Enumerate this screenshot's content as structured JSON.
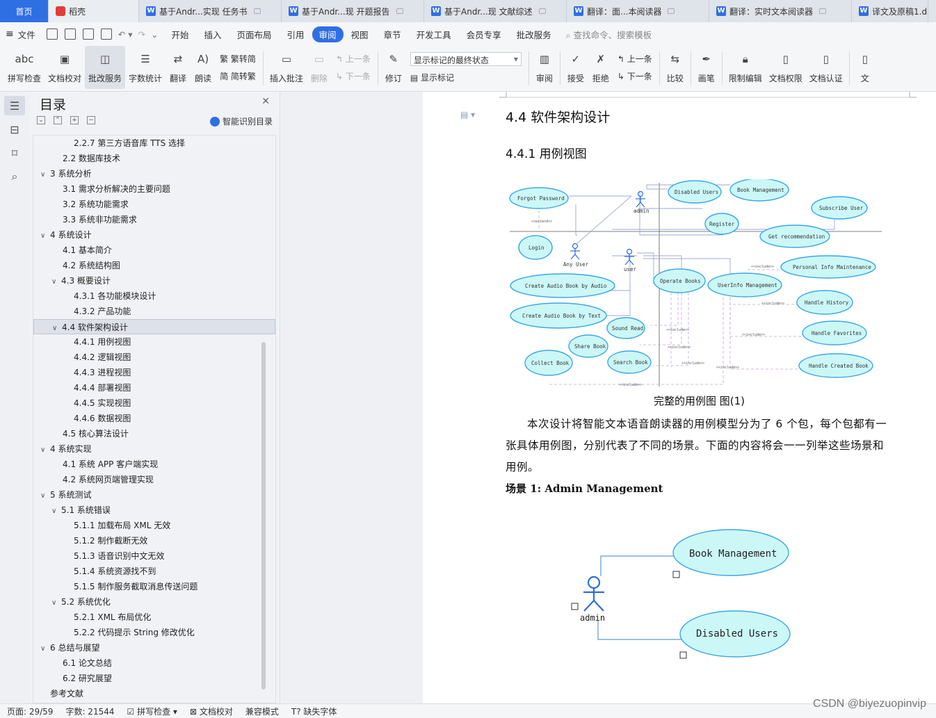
{
  "tabs": {
    "home": "首页",
    "daoke": "稻壳",
    "docs": [
      "基于Andr...实现 任务书",
      "基于Andr...现 开题报告",
      "基于Andr...现 文献综述",
      "翻译：面...本阅读器",
      "翻译：实时文本阅读器",
      "译文及原稿1.doc"
    ]
  },
  "menu": {
    "file": "文件",
    "items": [
      "开始",
      "插入",
      "页面布局",
      "引用",
      "审阅",
      "视图",
      "章节",
      "开发工具",
      "会员专享",
      "批改服务"
    ],
    "active": "审阅",
    "search": "查找命令、搜索模板"
  },
  "ribbon": {
    "spell": "拼写检查",
    "proof": "文档校对",
    "correct": "批改服务",
    "wordcount": "字数统计",
    "translate": "翻译",
    "read": "朗读",
    "trad": "繁转简",
    "simp": "简转繁",
    "insert_comment": "插入批注",
    "delete": "删除",
    "prev": "上一条",
    "next": "下一条",
    "revise": "修订",
    "display_state": "显示标记的最终状态",
    "show_marks": "显示标记",
    "review": "审阅",
    "accept": "接受",
    "reject": "拒绝",
    "prev2": "上一条",
    "next2": "下一条",
    "compare": "比较",
    "pen": "画笔",
    "restrict": "限制编辑",
    "rights": "文档权限",
    "certify": "文档认证",
    "more": "文"
  },
  "toc": {
    "title": "目录",
    "smart": "智能识别目录",
    "items": [
      {
        "text": "2.2.7 第三方语音库 TTS 选择",
        "lvl": 3
      },
      {
        "text": "2.2  数据库技术",
        "lvl": 2
      },
      {
        "text": "3 系统分析",
        "lvl": 1,
        "open": true
      },
      {
        "text": "3.1 需求分析解决的主要问题",
        "lvl": 2
      },
      {
        "text": "3.2 系统功能需求",
        "lvl": 2
      },
      {
        "text": "3.3 系统非功能需求",
        "lvl": 2
      },
      {
        "text": "4  系统设计",
        "lvl": 1,
        "open": true
      },
      {
        "text": "4.1 基本简介",
        "lvl": 2
      },
      {
        "text": "4.2 系统结构图",
        "lvl": 2
      },
      {
        "text": "4.3 概要设计",
        "lvl": 2,
        "open": true
      },
      {
        "text": "4.3.1 各功能模块设计",
        "lvl": 3
      },
      {
        "text": "4.3.2 产品功能",
        "lvl": 3
      },
      {
        "text": "4.4 软件架构设计",
        "lvl": 2,
        "open": true,
        "sel": true
      },
      {
        "text": "4.4.1 用例视图",
        "lvl": 3
      },
      {
        "text": "4.4.2 逻辑视图",
        "lvl": 3
      },
      {
        "text": "4.4.3 进程视图",
        "lvl": 3
      },
      {
        "text": "4.4.4 部署视图",
        "lvl": 3
      },
      {
        "text": "4.4.5 实现视图",
        "lvl": 3
      },
      {
        "text": "4.4.6 数据视图",
        "lvl": 3
      },
      {
        "text": "4.5 核心算法设计",
        "lvl": 2
      },
      {
        "text": "4 系统实现",
        "lvl": 1,
        "open": true
      },
      {
        "text": "4.1 系统 APP 客户端实现",
        "lvl": 2
      },
      {
        "text": "4.2 系统网页端管理实现",
        "lvl": 2
      },
      {
        "text": "5 系统测试",
        "lvl": 1,
        "open": true
      },
      {
        "text": "5.1 系统错误",
        "lvl": 2,
        "open": true
      },
      {
        "text": "5.1.1 加载布局 XML 无效",
        "lvl": 3
      },
      {
        "text": "5.1.2 制作截断无效",
        "lvl": 3
      },
      {
        "text": "5.1.3 语音识别中文无效",
        "lvl": 3
      },
      {
        "text": "5.1.4 系统资源找不到",
        "lvl": 3
      },
      {
        "text": "5.1.5 制作服务截取消息传送问题",
        "lvl": 3
      },
      {
        "text": "5.2 系统优化",
        "lvl": 2,
        "open": true
      },
      {
        "text": "5.2.1 XML 布局优化",
        "lvl": 3
      },
      {
        "text": "5.2.2 代码提示 String 修改优化",
        "lvl": 3
      },
      {
        "text": "6 总结与展望",
        "lvl": 1,
        "open": true
      },
      {
        "text": "6.1 论文总结",
        "lvl": 2
      },
      {
        "text": "6.2 研究展望",
        "lvl": 2
      },
      {
        "text": "参考文献",
        "lvl": 1
      }
    ]
  },
  "doc": {
    "h2": "4.4 软件架构设计",
    "h3": "4.4.1 用例视图",
    "caption": "完整的用例图        图(1)",
    "para1": "本次设计将智能文本语音朗读器的用例模型分为了 6 个包，每个包都有一",
    "para2": "张具体用例图，分别代表了不同的场景。下面的内容将会一一列举这些场景和",
    "para3": "用例。",
    "scene": "场景 1: Admin Management",
    "uc": {
      "forgot": "Forgot Password",
      "admin": "admin",
      "disabled": "Disabled Users",
      "bookmgmt": "Book Management",
      "subscribe": "Subscribe User",
      "register": "Register",
      "getrec": "Get recommendation",
      "login": "Login",
      "anyuser": "Any User",
      "user": "user",
      "personal": "Personal Info Maintenance",
      "operate": "Operate Books",
      "userinfo": "UserInfo Management",
      "createaudio": "Create Audio Book by Audio",
      "createtext": "Create Audio Book by Text",
      "history": "Handle History",
      "sound": "Sound Read",
      "favorites": "Handle Favorites",
      "share": "Share Book",
      "search": "Search Book",
      "collect": "Collect Book",
      "created": "Handle Created Book",
      "extend": "<<extend>>",
      "include": "<<include>>"
    },
    "scene1": {
      "admin": "admin",
      "bookmgmt": "Book Management",
      "disabled": "Disabled Users"
    }
  },
  "status": {
    "page": "页面: 29/59",
    "words": "字数: 21544",
    "spell": "拼写检查",
    "proof": "文档校对",
    "compat": "兼容模式",
    "font": "缺失字体"
  },
  "watermark": "CSDN @biyezuopinvip"
}
